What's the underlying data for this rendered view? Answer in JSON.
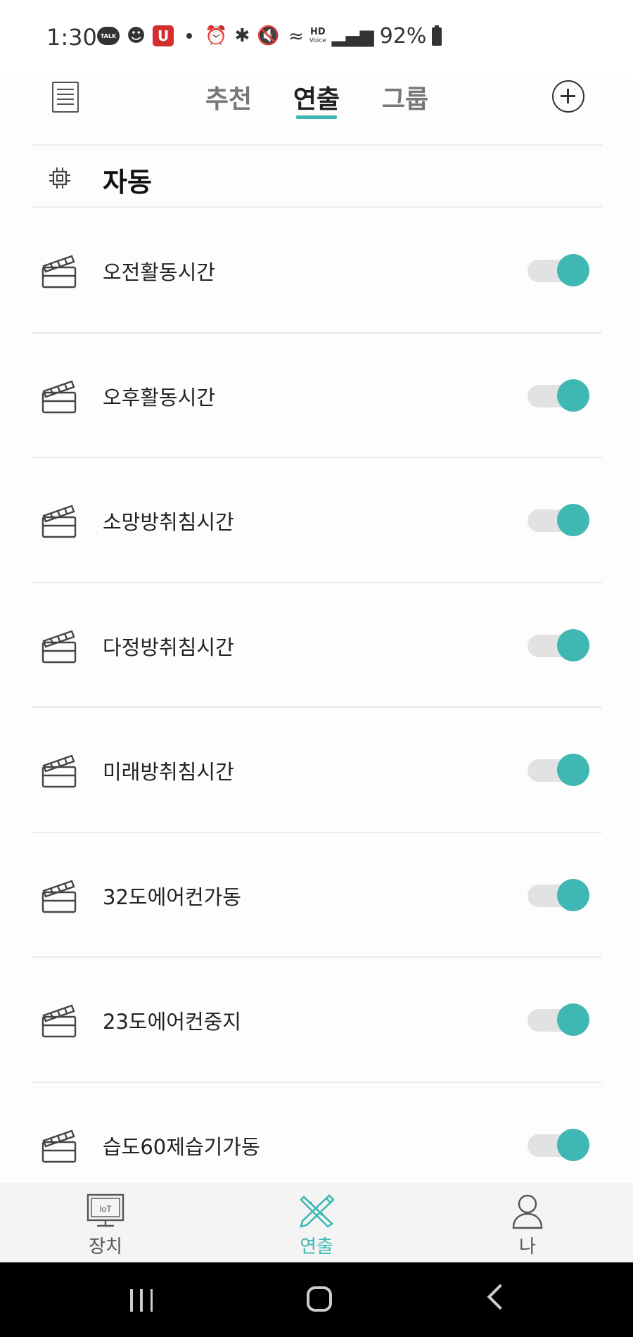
{
  "status_bar": {
    "time": "1:30",
    "talk_badge": "TALK",
    "u_badge": "U",
    "hd_label": "HD",
    "voice_label": "Voice",
    "battery": "92%",
    "icons": [
      "kakaotalk-icon",
      "person-icon",
      "u-app-icon",
      "dot-icon",
      "alarm-icon",
      "bluetooth-icon",
      "mute-icon",
      "wifi-icon",
      "hd-voice-icon",
      "signal-icon",
      "battery-icon"
    ]
  },
  "top_nav": {
    "tabs": [
      {
        "label": "추천",
        "active": false
      },
      {
        "label": "연출",
        "active": true
      },
      {
        "label": "그룹",
        "active": false
      }
    ]
  },
  "section": {
    "title": "자동"
  },
  "scenes": [
    {
      "name": "오전활동시간",
      "enabled": true
    },
    {
      "name": "오후활동시간",
      "enabled": true
    },
    {
      "name": "소망방취침시간",
      "enabled": true
    },
    {
      "name": "다정방취침시간",
      "enabled": true
    },
    {
      "name": "미래방취침시간",
      "enabled": true
    },
    {
      "name": "32도에어컨가동",
      "enabled": true
    },
    {
      "name": "23도에어컨중지",
      "enabled": true
    },
    {
      "name": "습도60제습기가동",
      "enabled": true
    }
  ],
  "bottom_nav": {
    "items": [
      {
        "label": "장치",
        "icon": "iot-monitor-icon",
        "badge": "IoT",
        "active": false
      },
      {
        "label": "연출",
        "icon": "pencil-ruler-icon",
        "active": true
      },
      {
        "label": "나",
        "icon": "person-icon",
        "active": false
      }
    ]
  },
  "colors": {
    "accent": "#3fb8b4",
    "toggle_track": "#e2e2e2",
    "divider": "#ececec"
  }
}
